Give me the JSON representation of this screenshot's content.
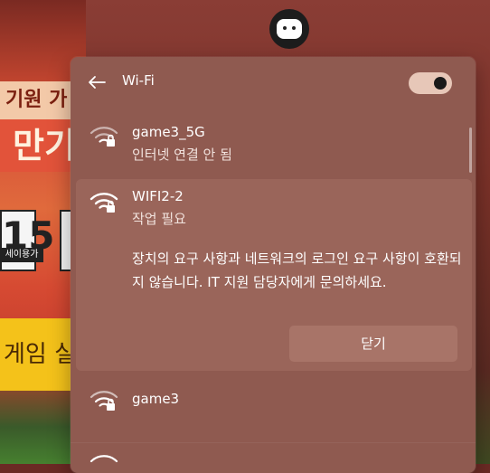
{
  "background": {
    "banner_text_1": "기원 가",
    "banner_text_2": "만기",
    "badge_number": "15",
    "badge_label": "세이용가",
    "cta_text": "게임 실"
  },
  "panel": {
    "title": "Wi-Fi",
    "wifi_enabled": true
  },
  "networks": [
    {
      "name": "game3_5G",
      "status": "인터넷 연결 안 됨",
      "secured": true
    },
    {
      "name": "WIFI2-2",
      "status": "작업 필요",
      "secured": true,
      "message": "장치의 요구 사항과 네트워크의 로그인 요구 사항이 호환되지 않습니다. IT 지원 담당자에게 문의하세요.",
      "close_label": "닫기"
    },
    {
      "name": "game3",
      "secured": true
    },
    {
      "name": "",
      "secured": false
    }
  ],
  "colors": {
    "panel_bg": "#8f5a50",
    "selected_bg": "#9a655a",
    "toggle_on": "#e7c7b8"
  }
}
